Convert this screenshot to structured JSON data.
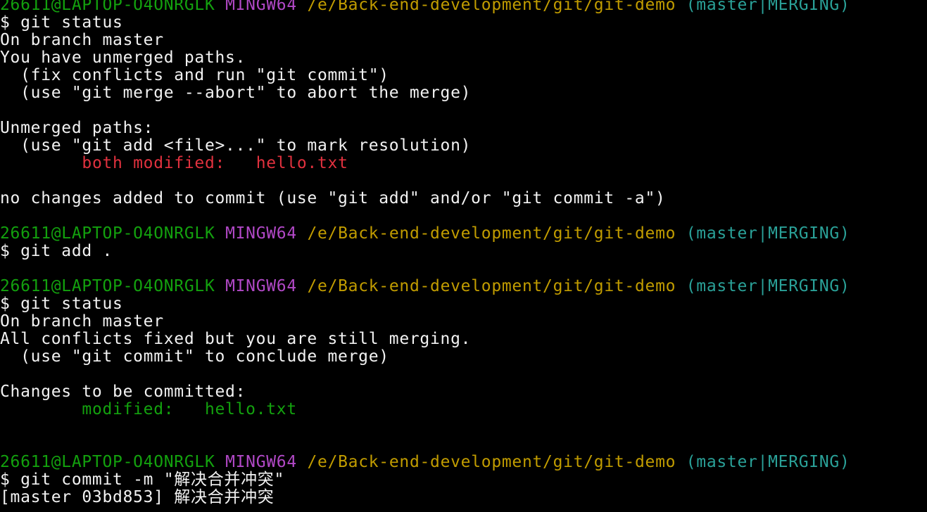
{
  "colors": {
    "background": "#000000",
    "default": "#f2f2f2",
    "user_host": "#13a10e",
    "mingw": "#b148c6",
    "path": "#c19c00",
    "branch": "#2aa198",
    "conflict": "#e0313e",
    "staged": "#13a10e"
  },
  "lines": [
    [
      {
        "t": "26611@LAPTOP-O4ONRGLK",
        "c": "user_host"
      },
      {
        "t": " "
      },
      {
        "t": "MINGW64",
        "c": "mingw"
      },
      {
        "t": " "
      },
      {
        "t": "/e/Back-end-development/git/git-demo",
        "c": "path"
      },
      {
        "t": " "
      },
      {
        "t": "(master|MERGING)",
        "c": "branch"
      }
    ],
    [
      {
        "t": "$ git status"
      }
    ],
    [
      {
        "t": "On branch master"
      }
    ],
    [
      {
        "t": "You have unmerged paths."
      }
    ],
    [
      {
        "t": "  (fix conflicts and run \"git commit\")"
      }
    ],
    [
      {
        "t": "  (use \"git merge --abort\" to abort the merge)"
      }
    ],
    [],
    [
      {
        "t": "Unmerged paths:"
      }
    ],
    [
      {
        "t": "  (use \"git add <file>...\" to mark resolution)"
      }
    ],
    [
      {
        "t": "        "
      },
      {
        "t": "both modified:   hello.txt",
        "c": "conflict"
      }
    ],
    [],
    [
      {
        "t": "no changes added to commit (use \"git add\" and/or \"git commit -a\")"
      }
    ],
    [],
    [
      {
        "t": "26611@LAPTOP-O4ONRGLK",
        "c": "user_host"
      },
      {
        "t": " "
      },
      {
        "t": "MINGW64",
        "c": "mingw"
      },
      {
        "t": " "
      },
      {
        "t": "/e/Back-end-development/git/git-demo",
        "c": "path"
      },
      {
        "t": " "
      },
      {
        "t": "(master|MERGING)",
        "c": "branch"
      }
    ],
    [
      {
        "t": "$ git add ."
      }
    ],
    [],
    [
      {
        "t": "26611@LAPTOP-O4ONRGLK",
        "c": "user_host"
      },
      {
        "t": " "
      },
      {
        "t": "MINGW64",
        "c": "mingw"
      },
      {
        "t": " "
      },
      {
        "t": "/e/Back-end-development/git/git-demo",
        "c": "path"
      },
      {
        "t": " "
      },
      {
        "t": "(master|MERGING)",
        "c": "branch"
      }
    ],
    [
      {
        "t": "$ git status"
      }
    ],
    [
      {
        "t": "On branch master"
      }
    ],
    [
      {
        "t": "All conflicts fixed but you are still merging."
      }
    ],
    [
      {
        "t": "  (use \"git commit\" to conclude merge)"
      }
    ],
    [],
    [
      {
        "t": "Changes to be committed:"
      }
    ],
    [
      {
        "t": "        "
      },
      {
        "t": "modified:   hello.txt",
        "c": "staged"
      }
    ],
    [],
    [],
    [
      {
        "t": "26611@LAPTOP-O4ONRGLK",
        "c": "user_host"
      },
      {
        "t": " "
      },
      {
        "t": "MINGW64",
        "c": "mingw"
      },
      {
        "t": " "
      },
      {
        "t": "/e/Back-end-development/git/git-demo",
        "c": "path"
      },
      {
        "t": " "
      },
      {
        "t": "(master|MERGING)",
        "c": "branch"
      }
    ],
    [
      {
        "t": "$ git commit -m \"解决合并冲突\""
      }
    ],
    [
      {
        "t": "[master 03bd853] 解决合并冲突"
      }
    ]
  ]
}
